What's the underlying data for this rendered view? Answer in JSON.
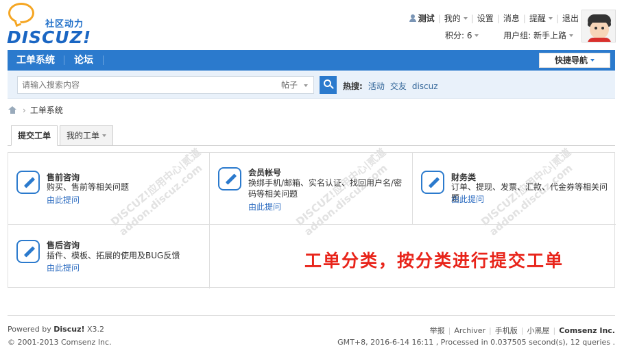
{
  "logo": {
    "slogan": "社区动力",
    "brand": "DISCUZ!"
  },
  "user_nav": {
    "username": "测试",
    "links": [
      "我的",
      "设置",
      "消息",
      "提醒",
      "退出"
    ],
    "points_label": "积分: 6",
    "group_label": "用户组: 新手上路"
  },
  "main_nav": {
    "items": [
      "工单系统",
      "论坛"
    ],
    "quick_nav_label": "快捷导航"
  },
  "search": {
    "placeholder": "请输入搜索内容",
    "type_value": "帖子",
    "hot_label": "热搜:",
    "hot_links": [
      "活动",
      "交友",
      "discuz"
    ]
  },
  "breadcrumb": {
    "current": "工单系统"
  },
  "tabs": [
    {
      "label": "提交工单",
      "active": true
    },
    {
      "label": "我的工单",
      "active": false
    }
  ],
  "categories": [
    {
      "title": "售前咨询",
      "desc": "购买、售前等相关问题",
      "link": "由此提问"
    },
    {
      "title": "会员帐号",
      "desc": "换绑手机/邮箱、实名认证、找回用户名/密码等相关问题",
      "link": "由此提问"
    },
    {
      "title": "财务类",
      "desc": "订单、提现、发票、汇款、代金券等相关问题",
      "link": "由此提问"
    },
    {
      "title": "售后咨询",
      "desc": "插件、模板、拓展的使用及BUG反馈",
      "link": "由此提问"
    }
  ],
  "annotation": "工单分类，按分类进行提交工单",
  "watermark": {
    "line1": "DISCUZ!应用中心|贰道",
    "line2": "addon.discuz.com"
  },
  "footer": {
    "powered_prefix": "Powered by",
    "powered_brand": "Discuz!",
    "version": "X3.2",
    "copyright": "© 2001-2013 Comsenz Inc.",
    "links": [
      "举报",
      "Archiver",
      "手机版",
      "小黑屋"
    ],
    "company": "Comsenz Inc.",
    "stats": "GMT+8, 2016-6-14 16:11 , Processed in 0.037505 second(s), 12 queries ."
  },
  "colors": {
    "brand_blue": "#2b7acd",
    "annotation_red": "#e8241a",
    "logo_orange": "#f5a623"
  }
}
